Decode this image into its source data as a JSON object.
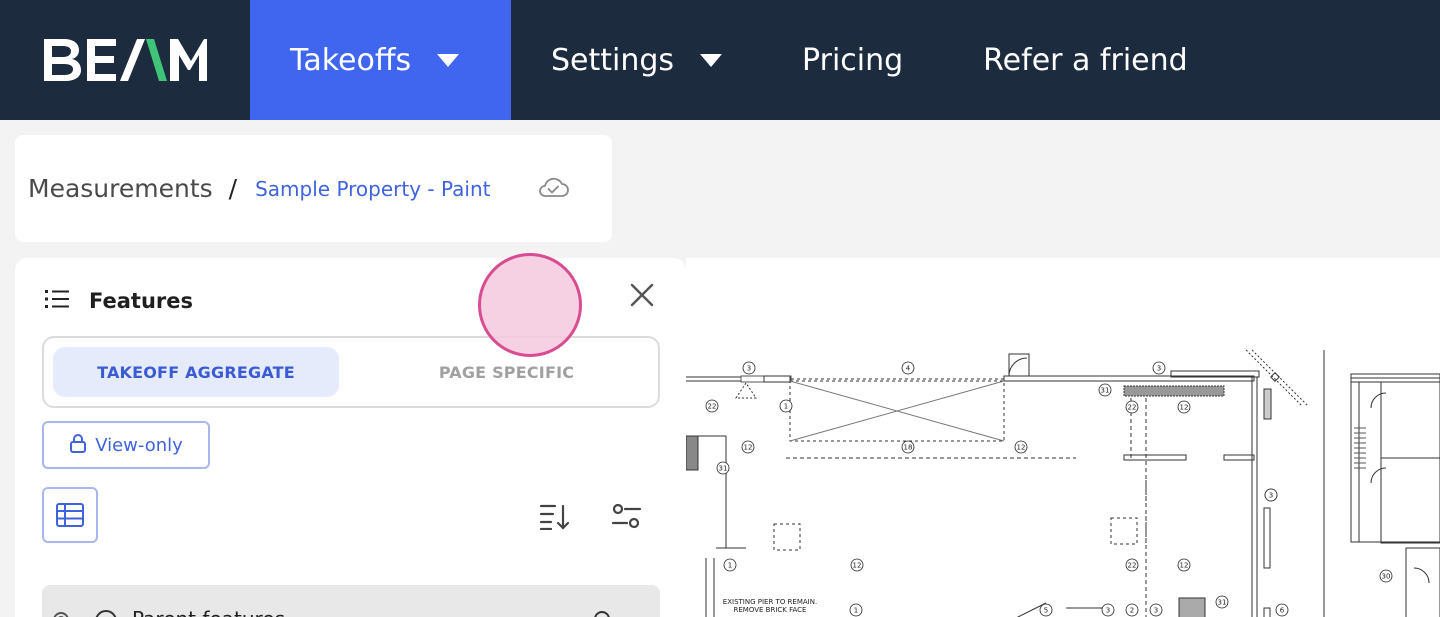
{
  "nav": {
    "logo": "BEAM",
    "items": [
      {
        "label": "Takeoffs",
        "active": true,
        "dropdown": true
      },
      {
        "label": "Settings",
        "active": false,
        "dropdown": true
      },
      {
        "label": "Pricing",
        "active": false,
        "dropdown": false
      },
      {
        "label": "Refer a friend",
        "active": false,
        "dropdown": false
      }
    ]
  },
  "breadcrumb": {
    "root": "Measurements",
    "separator": "/",
    "current": "Sample Property - Paint",
    "sync_icon": "cloud-check-icon"
  },
  "features": {
    "title": "Features",
    "toggle": {
      "selected": "TAKEOFF AGGREGATE",
      "other": "PAGE SPECIFIC"
    },
    "view_only_label": "View-only",
    "first_row_label": "Parent features"
  },
  "drawing": {
    "note": "EXISTING PIER TO REMAIN. REMOVE BRICK FACE",
    "tags": [
      "3",
      "4",
      "3",
      "31",
      "22",
      "12",
      "1",
      "22",
      "12",
      "18",
      "12",
      "31",
      "3",
      "1",
      "12",
      "22",
      "12",
      "3",
      "30",
      "5",
      "3",
      "2",
      "3",
      "31",
      "6",
      "1"
    ]
  },
  "colors": {
    "nav_bg": "#1c2b3e",
    "nav_active": "#4066f0",
    "accent": "#3e63dd",
    "logo_green": "#3fc378"
  }
}
